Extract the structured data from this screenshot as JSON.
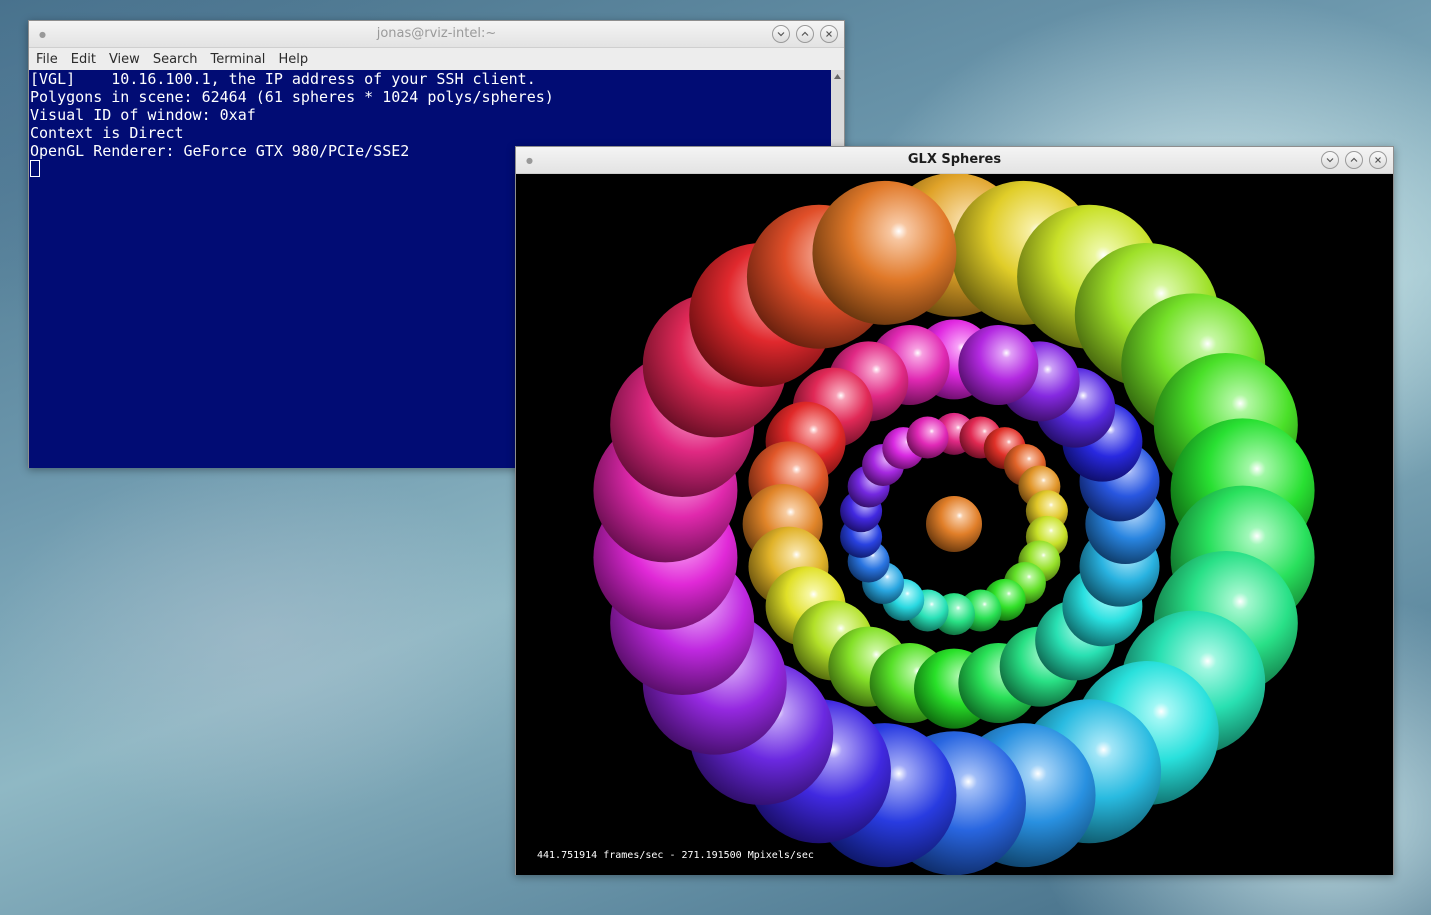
{
  "terminal": {
    "title": "jonas@rviz-intel:~",
    "menu": [
      "File",
      "Edit",
      "View",
      "Search",
      "Terminal",
      "Help"
    ],
    "lines": [
      "[VGL]    10.16.100.1, the IP address of your SSH client.",
      "Polygons in scene: 62464 (61 spheres * 1024 polys/spheres)",
      "Visual ID of window: 0xaf",
      "Context is Direct",
      "OpenGL Renderer: GeForce GTX 980/PCIe/SSE2"
    ],
    "colors": {
      "background": "#010c74",
      "text": "#ffffff"
    }
  },
  "glx": {
    "title": "GLX Spheres",
    "fps_text": "441.751914 frames/sec - 271.191500 Mpixels/sec"
  },
  "window_buttons": [
    "minimize",
    "maximize",
    "close"
  ]
}
